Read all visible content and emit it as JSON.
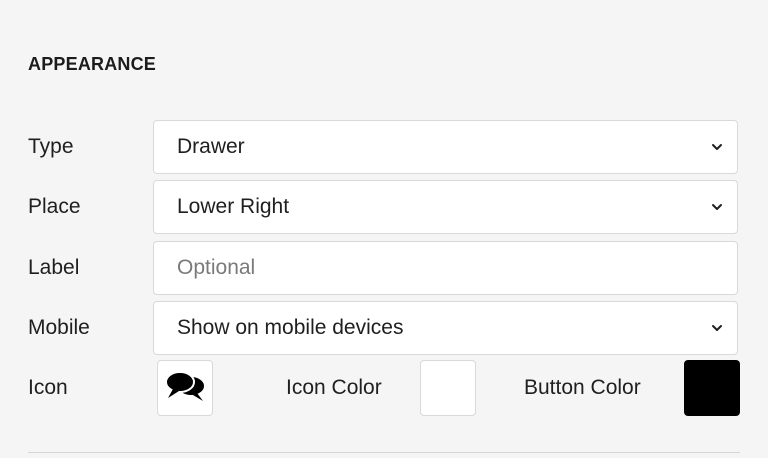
{
  "section": {
    "title": "APPEARANCE"
  },
  "fields": {
    "type": {
      "label": "Type",
      "value": "Drawer",
      "icon": "chevron-down-icon"
    },
    "place": {
      "label": "Place",
      "value": "Lower Right",
      "icon": "chevron-down-icon"
    },
    "label": {
      "label": "Label",
      "value": "",
      "placeholder": "Optional"
    },
    "mobile": {
      "label": "Mobile",
      "value": "Show on mobile devices",
      "icon": "chevron-down-icon"
    }
  },
  "icon_settings": {
    "icon_label": "Icon",
    "icon_glyph": "chat-bubbles-icon",
    "icon_color_label": "Icon Color",
    "icon_color": "#ffffff",
    "button_color_label": "Button Color",
    "button_color": "#000000"
  }
}
